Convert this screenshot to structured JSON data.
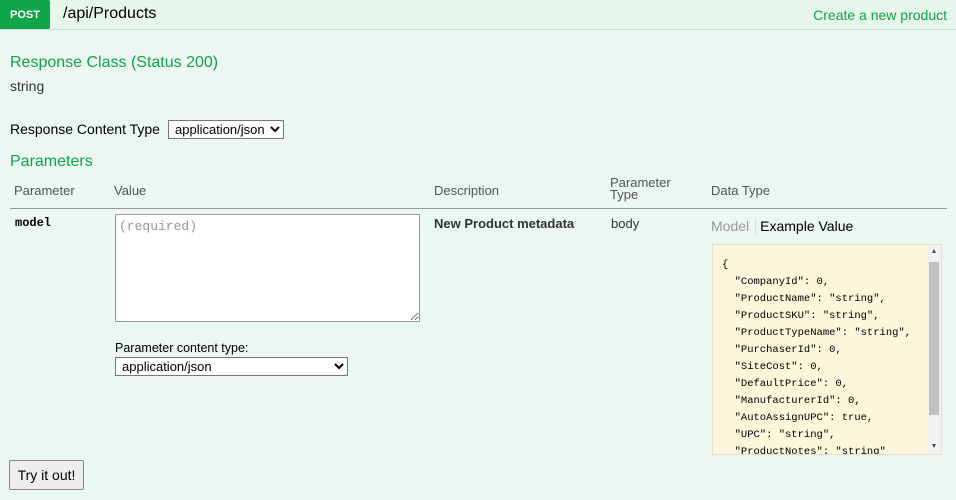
{
  "operation": {
    "method": "POST",
    "path": "/api/Products",
    "summary": "Create a new product"
  },
  "response_class": {
    "heading": "Response Class (Status 200)",
    "type": "string"
  },
  "response_content_type": {
    "label": "Response Content Type",
    "selected": "application/json"
  },
  "parameters": {
    "heading": "Parameters",
    "columns": [
      "Parameter",
      "Value",
      "Description",
      "Parameter Type",
      "Data Type"
    ],
    "rows": [
      {
        "name": "model",
        "value_placeholder": "(required)",
        "description": "New Product metadata",
        "param_type": "body",
        "content_type_label": "Parameter content type:",
        "content_type_selected": "application/json",
        "data_type_tabs": [
          "Model",
          "Example Value"
        ],
        "example_value": "{\n  \"CompanyId\": 0,\n  \"ProductName\": \"string\",\n  \"ProductSKU\": \"string\",\n  \"ProductTypeName\": \"string\",\n  \"PurchaserId\": 0,\n  \"SiteCost\": 0,\n  \"DefaultPrice\": 0,\n  \"ManufacturerId\": 0,\n  \"AutoAssignUPC\": true,\n  \"UPC\": \"string\",\n  \"ProductNotes\": \"string\""
      }
    ]
  },
  "actions": {
    "try_label": "Try it out!"
  }
}
